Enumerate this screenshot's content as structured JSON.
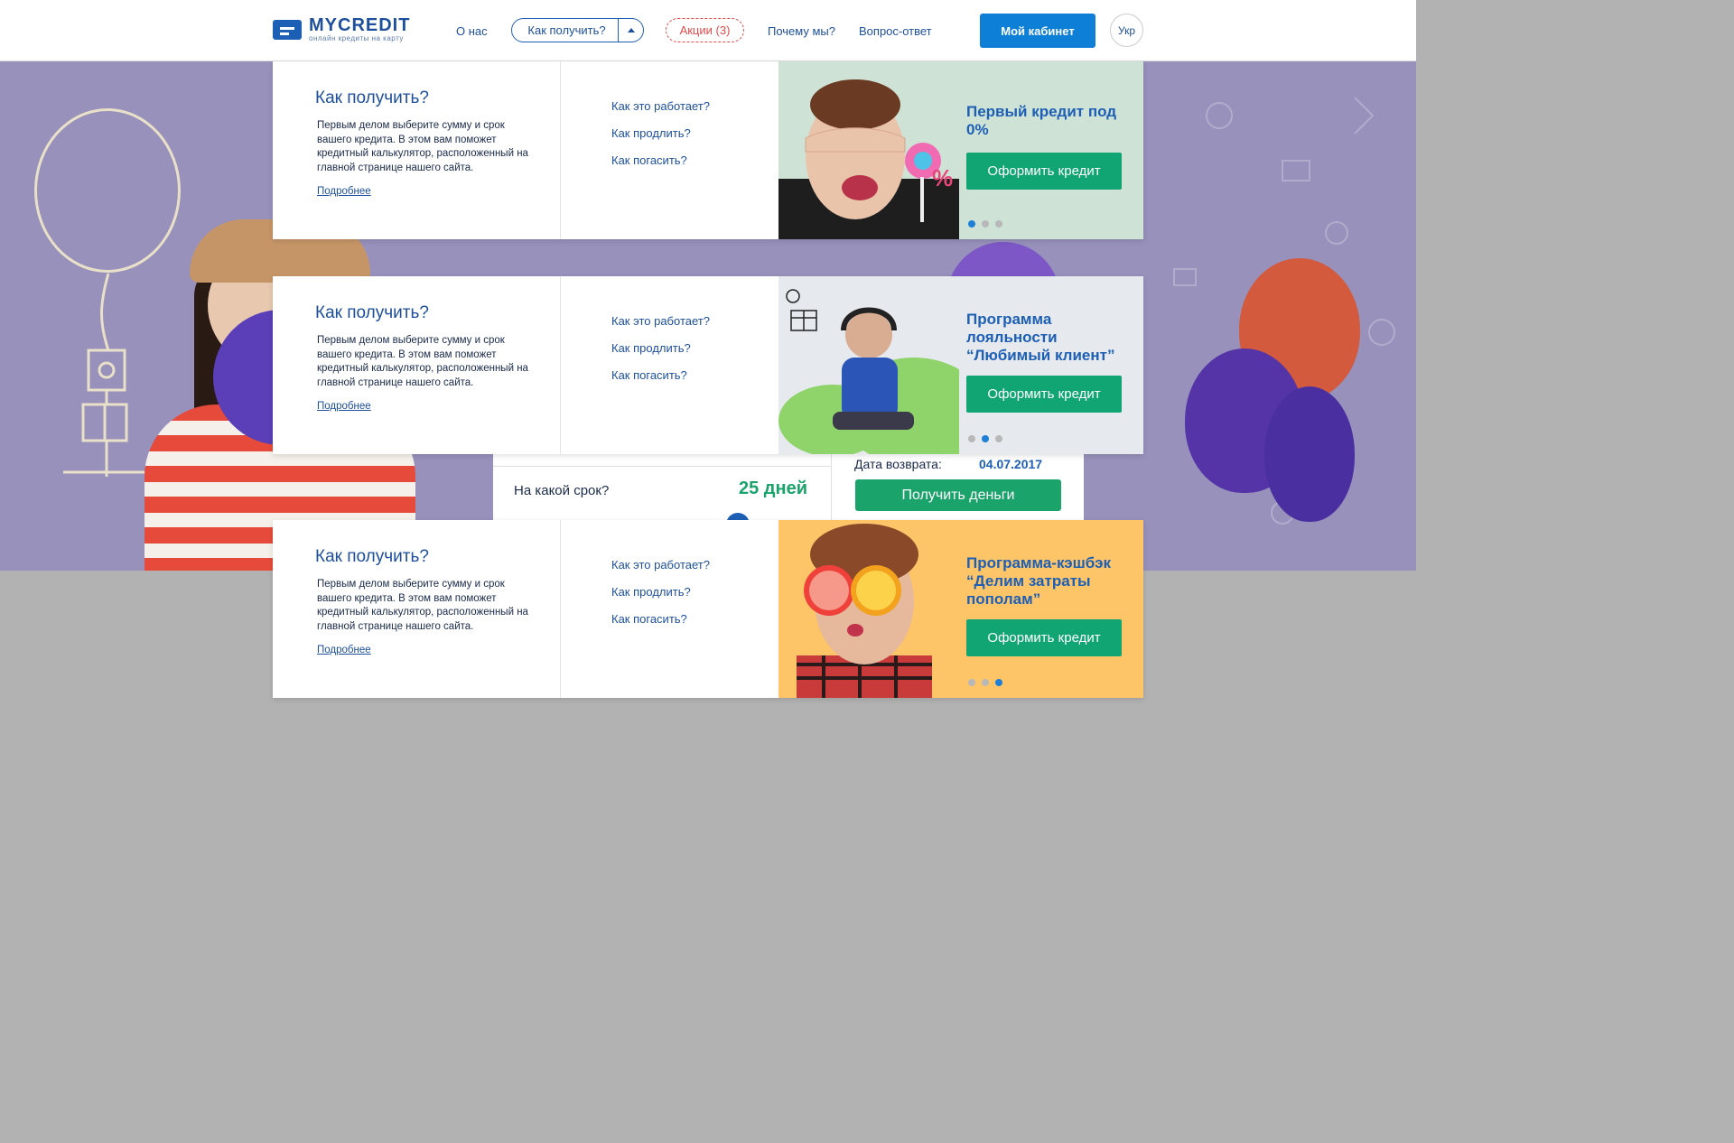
{
  "header": {
    "logo_name": "MYCREDIT",
    "logo_sub": "онлайн кредиты на карту",
    "nav": {
      "about": "О нас",
      "how": "Как получить?",
      "promo": "Акции (3)",
      "why": "Почему мы?",
      "faq": "Вопрос-ответ"
    },
    "cabinet": "Мой кабинет",
    "lang": "Укр"
  },
  "calculator": {
    "term_label": "На какой срок?",
    "term_value": "25 дней",
    "return_label": "Дата возврата:",
    "return_value": "04.07.2017",
    "submit": "Получить деньги"
  },
  "dropdown": {
    "title": "Как получить?",
    "text": "Первым делом выберите сумму и срок вашего кредита. В этом вам поможет кредитный калькулятор, расположенный на главной странице нашего сайта.",
    "more": "Подробнее",
    "links": [
      "Как это работает?",
      "Как продлить?",
      "Как погасить?"
    ]
  },
  "banners": [
    {
      "title": "Первый кредит под 0%",
      "button": "Оформить кредит",
      "active_dot": 0,
      "bg": "#cfe2d6"
    },
    {
      "title": "Программа лояльности “Любимый клиент”",
      "button": "Оформить кредит",
      "active_dot": 1,
      "bg": "#e6eaee"
    },
    {
      "title": "Программа-кэшбэк “Делим затраты пополам”",
      "button": "Оформить кредит",
      "active_dot": 2,
      "bg": "#fdc567"
    }
  ],
  "colors": {
    "brand": "#1d5fb4",
    "accent_green": "#12a574",
    "promo_red": "#e24a4a",
    "hero_bg": "#9791bb"
  }
}
